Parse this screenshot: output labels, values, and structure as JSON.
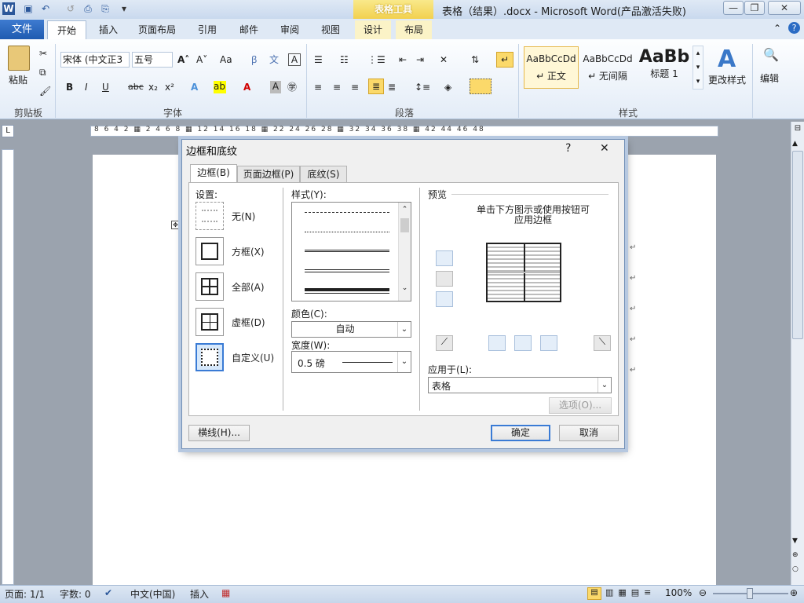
{
  "titlebar": {
    "context_label": "表格工具",
    "title": "表格（结果）.docx  -  Microsoft Word(产品激活失败)",
    "minimize": "—",
    "restore": "❐",
    "close": "✕"
  },
  "tabs": {
    "file": "文件",
    "home": "开始",
    "insert": "插入",
    "page_layout": "页面布局",
    "references": "引用",
    "mailings": "邮件",
    "review": "审阅",
    "view": "视图",
    "design": "设计",
    "layout": "布局"
  },
  "ribbon": {
    "clipboard": {
      "paste": "粘贴",
      "label": "剪贴板"
    },
    "font": {
      "font_name": "宋体 (中文正3",
      "font_size": "五号",
      "label": "字体"
    },
    "paragraph": {
      "label": "段落"
    },
    "styles": {
      "label": "样式",
      "items": [
        {
          "preview": "AaBbCcDd",
          "name": "↵ 正文"
        },
        {
          "preview": "AaBbCcDd",
          "name": "↵ 无间隔"
        },
        {
          "preview": "AaBb",
          "name": "标题 1"
        }
      ],
      "change_styles": "更改样式"
    },
    "editing": {
      "label": "编辑"
    }
  },
  "ruler": {
    "numbers": "8 6 4 2 ▦ 2 4 6 8 ▦ 12 14 16 18 ▦ 22 24 26 28 ▦ 32 34 36 38 ▦ 42 44 46 48"
  },
  "status": {
    "page": "页面: 1/1",
    "words": "字数: 0",
    "language": "中文(中国)",
    "mode": "插入",
    "zoom": "100%"
  },
  "dialog": {
    "title": "边框和底纹",
    "help": "?",
    "close": "✕",
    "tabs": [
      "边框(B)",
      "页面边框(P)",
      "底纹(S)"
    ],
    "settings_label": "设置:",
    "settings": [
      "无(N)",
      "方框(X)",
      "全部(A)",
      "虚框(D)",
      "自定义(U)"
    ],
    "style_label": "样式(Y):",
    "color_label": "颜色(C):",
    "color_value": "自动",
    "width_label": "宽度(W):",
    "width_value": "0.5 磅",
    "preview_label": "预览",
    "preview_hint_1": "单击下方图示或使用按钮可",
    "preview_hint_2": "应用边框",
    "apply_label": "应用于(L):",
    "apply_value": "表格",
    "options_button": "选项(O)...",
    "hline_button": "横线(H)...",
    "ok_button": "确定",
    "cancel_button": "取消"
  }
}
